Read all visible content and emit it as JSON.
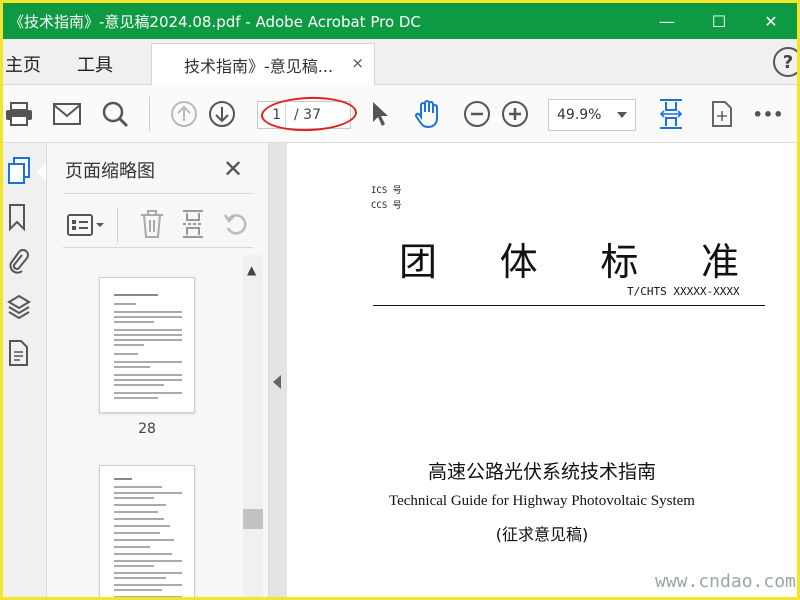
{
  "window": {
    "title": "《技术指南》-意见稿2024.08.pdf - Adobe Acrobat Pro DC",
    "controls": {
      "minimize": "—",
      "maximize": "☐",
      "close": "✕"
    }
  },
  "tabs": {
    "home": "主页",
    "tools": "工具",
    "document": "技术指南》-意见稿...",
    "close": "×"
  },
  "toolbar": {
    "page_current": "1",
    "page_total": "/ 37",
    "zoom": "49.9%",
    "more": "•••"
  },
  "panel": {
    "title": "页面缩略图",
    "close": "✕",
    "thumbnails": [
      {
        "page_number": "28"
      }
    ]
  },
  "document": {
    "ics": "ICS 号",
    "ccs": "CCS 号",
    "standard_chars": [
      "团",
      "体",
      "标",
      "准"
    ],
    "code": "T/CHTS XXXXX-XXXX",
    "title_cn": "高速公路光伏系统技术指南",
    "title_en": "Technical Guide for Highway Photovoltaic System",
    "draft": "(征求意见稿)"
  },
  "watermark": "www.cndao.com",
  "colors": {
    "titlebar": "#0e9a42",
    "frame": "#f5e52a",
    "accent_blue": "#1a73d9",
    "annotation_red": "#e0201e"
  },
  "icons": [
    "print-icon",
    "mail-icon",
    "search-icon",
    "page-up-icon",
    "page-down-icon",
    "pointer-icon",
    "hand-icon",
    "zoom-out-icon",
    "zoom-in-icon",
    "fit-width-icon",
    "rotate-view-icon",
    "more-icon"
  ]
}
